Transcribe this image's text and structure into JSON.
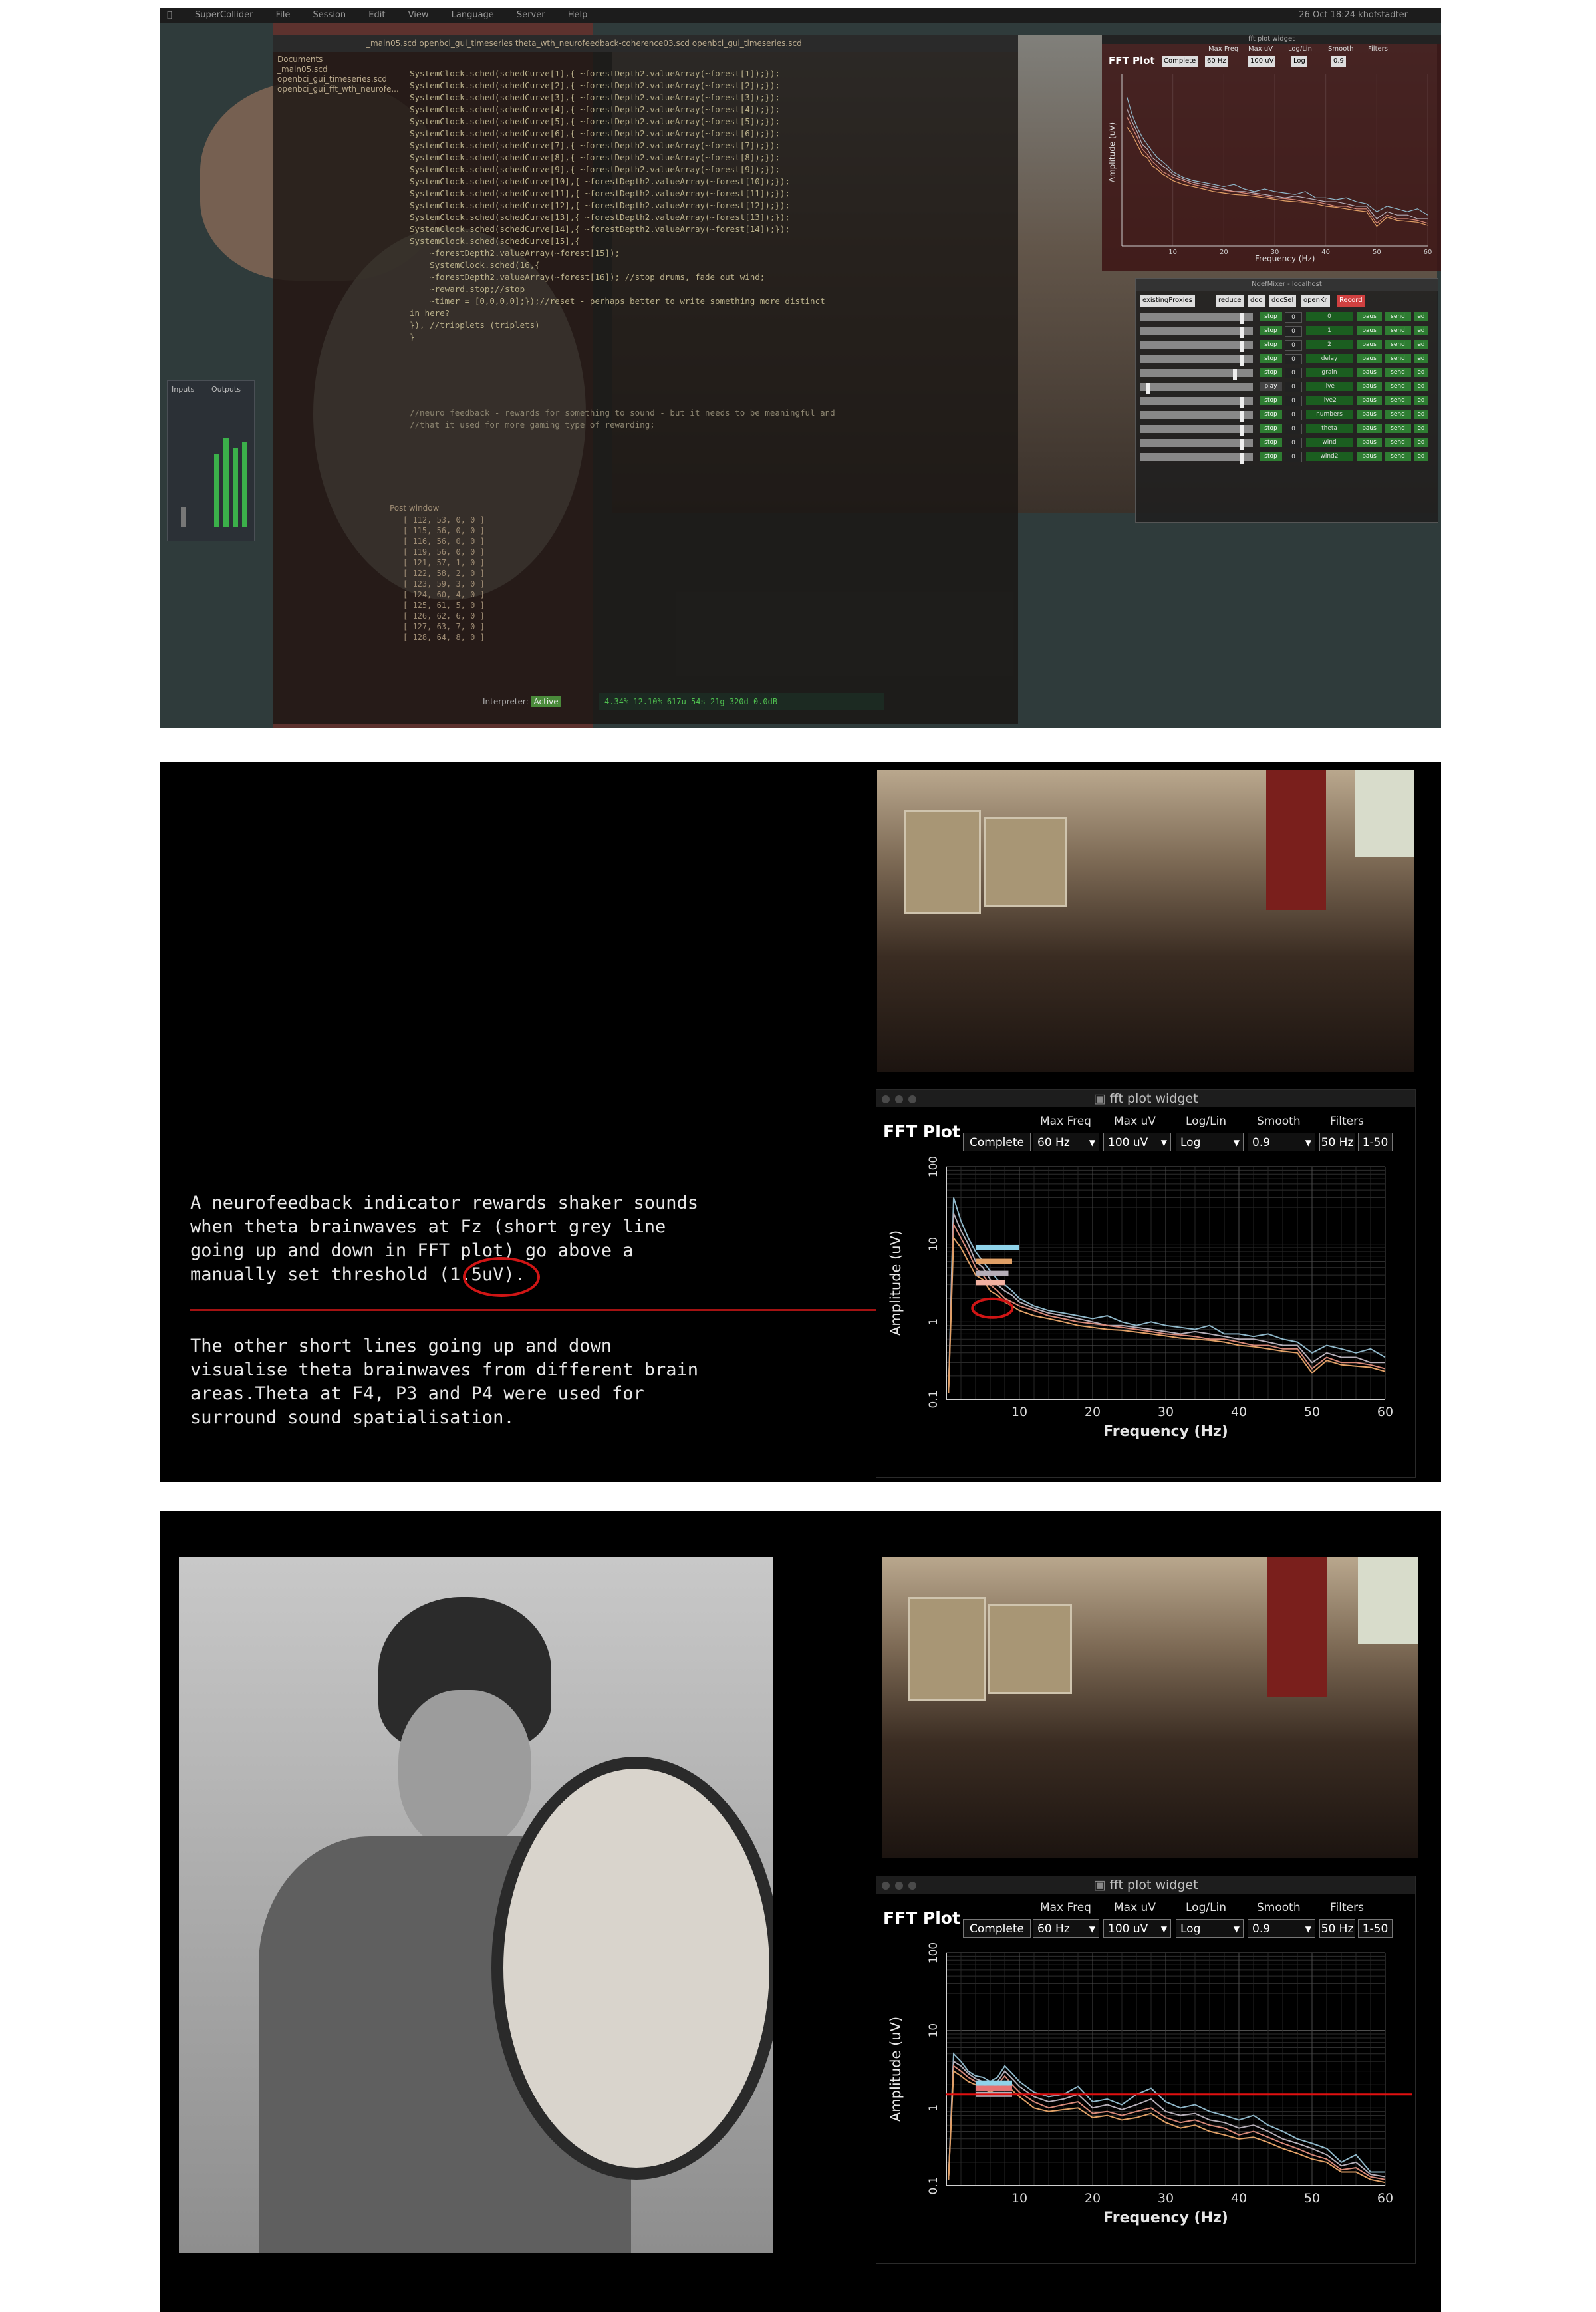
{
  "panel1": {
    "menubar": [
      "SuperCollider",
      "File",
      "Session",
      "Edit",
      "View",
      "Language",
      "Server",
      "Help"
    ],
    "clock": "26 Oct 18:24  khofstadter",
    "editor_tabs": "_main05.scd   openbci_gui_timeseries   theta_wth_neurofeedback-coherence03.scd   openbci_gui_timeseries.scd",
    "documents_label": "Documents",
    "documents": [
      "_main05.scd",
      "openbci_gui_timeseries.scd",
      "openbci_gui_fft_wth_neurofe..."
    ],
    "code_lines": [
      "SystemClock.sched(schedCurve[1],{ ~forestDepth2.valueArray(~forest[1]);});",
      "SystemClock.sched(schedCurve[2],{ ~forestDepth2.valueArray(~forest[2]);});",
      "SystemClock.sched(schedCurve[3],{ ~forestDepth2.valueArray(~forest[3]);});",
      "SystemClock.sched(schedCurve[4],{ ~forestDepth2.valueArray(~forest[4]);});",
      "SystemClock.sched(schedCurve[5],{ ~forestDepth2.valueArray(~forest[5]);});",
      "SystemClock.sched(schedCurve[6],{ ~forestDepth2.valueArray(~forest[6]);});",
      "SystemClock.sched(schedCurve[7],{ ~forestDepth2.valueArray(~forest[7]);});",
      "SystemClock.sched(schedCurve[8],{ ~forestDepth2.valueArray(~forest[8]);});",
      "SystemClock.sched(schedCurve[9],{ ~forestDepth2.valueArray(~forest[9]);});",
      "SystemClock.sched(schedCurve[10],{ ~forestDepth2.valueArray(~forest[10]);});",
      "SystemClock.sched(schedCurve[11],{ ~forestDepth2.valueArray(~forest[11]);});",
      "SystemClock.sched(schedCurve[12],{ ~forestDepth2.valueArray(~forest[12]);});",
      "SystemClock.sched(schedCurve[13],{ ~forestDepth2.valueArray(~forest[13]);});",
      "SystemClock.sched(schedCurve[14],{ ~forestDepth2.valueArray(~forest[14]);});",
      "SystemClock.sched(schedCurve[15],{",
      "    ~forestDepth2.valueArray(~forest[15]);",
      "    SystemClock.sched(16,{",
      "    ~forestDepth2.valueArray(~forest[16]); //stop drums, fade out wind;",
      "    ~reward.stop;//stop",
      "    ~timer = [0,0,0,0];});//reset - perhaps better to write something more distinct",
      "in here?",
      "}), //tripplets (triplets)",
      "",
      "}"
    ],
    "comment_lines": [
      "//neuro feedback - rewards for something to sound - but it needs to be meaningful and",
      "//that it used for more gaming type of rewarding;"
    ],
    "post_window_label": "Post window",
    "post_lines": [
      "[ 112, 53, 0, 0 ]",
      "[ 115, 56, 0, 0 ]",
      "[ 116, 56, 0, 0 ]",
      "[ 119, 56, 0, 0 ]",
      "[ 121, 57, 1, 0 ]",
      "[ 122, 58, 2, 0 ]",
      "[ 123, 59, 3, 0 ]",
      "[ 124, 60, 4, 0 ]",
      "[ 125, 61, 5, 0 ]",
      "[ 126, 62, 6, 0 ]",
      "[ 127, 63, 7, 0 ]",
      "[ 128, 64, 8, 0 ]"
    ],
    "interpreter_label": "Interpreter:",
    "interpreter_state": "Active",
    "server_status": "4.34% 12.10% 617u 54s 21g 320d 0.0dB",
    "meters_inputs": "Inputs",
    "meters_outputs": "Outputs",
    "mini_fft": {
      "title": "FFT Plot",
      "labels": [
        "Max Freq",
        "Max uV",
        "Log/Lin",
        "Smooth",
        "Filters"
      ],
      "controls": [
        "Complete",
        "60 Hz",
        "100 uV",
        "Log",
        "0.9"
      ],
      "ylabel": "Amplitude (uV)",
      "xlabel": "Frequency (Hz)",
      "xticks": [
        "10",
        "20",
        "30",
        "40",
        "50",
        "60"
      ],
      "window_title": "fft plot widget"
    },
    "mixer": {
      "window_title": "NdefMixer - localhost",
      "buttons": [
        "existingProxies",
        "reduce",
        "doc",
        "docSel",
        "openKr",
        "Record"
      ],
      "rows": [
        {
          "state": "stop",
          "n": "0",
          "name": "0"
        },
        {
          "state": "stop",
          "n": "0",
          "name": "1"
        },
        {
          "state": "stop",
          "n": "0",
          "name": "2"
        },
        {
          "state": "stop",
          "n": "0",
          "name": "delay"
        },
        {
          "state": "stop",
          "n": "0",
          "name": "grain"
        },
        {
          "state": "play",
          "n": "0",
          "name": "live"
        },
        {
          "state": "stop",
          "n": "0",
          "name": "live2"
        },
        {
          "state": "stop",
          "n": "0",
          "name": "numbers"
        },
        {
          "state": "stop",
          "n": "0",
          "name": "theta"
        },
        {
          "state": "stop",
          "n": "0",
          "name": "wind"
        },
        {
          "state": "stop",
          "n": "0",
          "name": "wind2"
        }
      ],
      "pause_label": "paus",
      "send_label": "send",
      "ed_label": "ed"
    }
  },
  "panel2": {
    "paragraph1": "A neurofeedback indicator rewards shaker sounds\nwhen theta brainwaves at Fz (short grey line\ngoing up and down in FFT plot) go above a\nmanually set threshold (1.5uV).",
    "paragraph2": "The other short lines going up and down\nvisualise theta brainwaves from different brain\nareas.Theta at F4, P3 and P4 were used for\nsurround sound spatialisation."
  },
  "fft_widget": {
    "window_title": "fft plot widget",
    "title": "FFT Plot",
    "labels": {
      "max_freq": "Max Freq",
      "max_uv": "Max uV",
      "log_lin": "Log/Lin",
      "smooth": "Smooth",
      "filters": "Filters"
    },
    "controls": {
      "complete": "Complete",
      "max_freq": "60 Hz",
      "max_uv": "100 uV",
      "log_lin": "Log",
      "smooth": "0.9",
      "notch": "50 Hz",
      "band": "1-50"
    },
    "ylabel": "Amplitude (uV)",
    "xlabel": "Frequency (Hz)",
    "yticks": [
      "100",
      "10",
      "1",
      "0.1"
    ],
    "xticks": [
      "10",
      "20",
      "30",
      "40",
      "50",
      "60"
    ]
  },
  "colors": {
    "accent_red": "#d01515",
    "divider_red": "#a31212",
    "series": [
      "#8fb7c9",
      "#b5aeb8",
      "#d88a7a",
      "#e0a066",
      "#c9c9c9",
      "#e57373",
      "#f1b0a0"
    ]
  },
  "chart_data": [
    {
      "type": "line",
      "title": "FFT Plot",
      "xlabel": "Frequency (Hz)",
      "ylabel": "Amplitude (uV)",
      "xlim": [
        0,
        60
      ],
      "ylim": [
        0.1,
        100
      ],
      "yscale": "log",
      "grid": true,
      "x": [
        1,
        2,
        3,
        4,
        5,
        6,
        7,
        8,
        9,
        10,
        12,
        14,
        16,
        18,
        20,
        22,
        24,
        26,
        28,
        30,
        32,
        34,
        36,
        38,
        40,
        42,
        44,
        46,
        48,
        50,
        52,
        54,
        56,
        58,
        60
      ],
      "series": [
        {
          "values": [
            40,
            20,
            12,
            8,
            6,
            4.5,
            3.5,
            3,
            2.5,
            2,
            1.6,
            1.4,
            1.3,
            1.2,
            1.1,
            1.2,
            1.0,
            0.9,
            1.0,
            0.9,
            0.85,
            0.8,
            0.9,
            0.7,
            0.7,
            0.65,
            0.7,
            0.6,
            0.55,
            0.4,
            0.5,
            0.45,
            0.4,
            0.45,
            0.35
          ]
        },
        {
          "values": [
            25,
            15,
            10,
            6,
            5,
            3.5,
            3,
            2.5,
            2.2,
            1.8,
            1.5,
            1.3,
            1.2,
            1.1,
            1.0,
            0.9,
            0.9,
            0.85,
            0.8,
            0.75,
            0.7,
            0.75,
            0.7,
            0.65,
            0.6,
            0.6,
            0.55,
            0.5,
            0.5,
            0.3,
            0.4,
            0.35,
            0.35,
            0.3,
            0.3
          ]
        },
        {
          "values": [
            18,
            12,
            8,
            5,
            4,
            3,
            2.5,
            2,
            1.8,
            1.6,
            1.4,
            1.2,
            1.1,
            1.0,
            0.95,
            0.9,
            0.85,
            0.8,
            0.75,
            0.7,
            0.68,
            0.65,
            0.6,
            0.6,
            0.55,
            0.5,
            0.5,
            0.45,
            0.45,
            0.25,
            0.35,
            0.3,
            0.3,
            0.28,
            0.25
          ]
        },
        {
          "values": [
            12,
            9,
            6,
            4,
            3.5,
            2.5,
            2.2,
            1.8,
            1.6,
            1.4,
            1.2,
            1.1,
            1.0,
            0.9,
            0.85,
            0.8,
            0.78,
            0.74,
            0.7,
            0.66,
            0.62,
            0.6,
            0.58,
            0.55,
            0.5,
            0.48,
            0.45,
            0.42,
            0.4,
            0.22,
            0.32,
            0.28,
            0.27,
            0.26,
            0.23
          ]
        }
      ],
      "annotations": [
        "threshold circle at 1.5uV"
      ]
    },
    {
      "type": "line",
      "title": "FFT Plot",
      "xlabel": "Frequency (Hz)",
      "ylabel": "Amplitude (uV)",
      "xlim": [
        0,
        60
      ],
      "ylim": [
        0.1,
        100
      ],
      "yscale": "log",
      "grid": true,
      "threshold": 1.5,
      "x": [
        1,
        2,
        3,
        4,
        5,
        6,
        7,
        8,
        9,
        10,
        12,
        14,
        16,
        18,
        20,
        22,
        24,
        26,
        28,
        30,
        32,
        34,
        36,
        38,
        40,
        42,
        44,
        46,
        48,
        50,
        52,
        54,
        56,
        58,
        60
      ],
      "series": [
        {
          "values": [
            5,
            4,
            3,
            2.6,
            2.5,
            2.2,
            2.5,
            3.5,
            2.8,
            2.2,
            1.6,
            1.4,
            1.5,
            1.9,
            1.2,
            1.3,
            1.1,
            1.5,
            1.8,
            1.2,
            1.0,
            1.1,
            0.9,
            0.8,
            0.7,
            0.8,
            0.6,
            0.5,
            0.4,
            0.35,
            0.3,
            0.2,
            0.25,
            0.15,
            0.15
          ]
        },
        {
          "values": [
            4,
            3.5,
            2.8,
            2.4,
            2.2,
            2.0,
            2.2,
            3.0,
            2.4,
            1.9,
            1.4,
            1.2,
            1.3,
            1.5,
            1.0,
            1.1,
            0.95,
            1.1,
            1.3,
            0.9,
            0.8,
            0.85,
            0.7,
            0.65,
            0.55,
            0.6,
            0.5,
            0.4,
            0.35,
            0.3,
            0.25,
            0.18,
            0.2,
            0.14,
            0.13
          ]
        },
        {
          "values": [
            3.5,
            3,
            2.5,
            2.2,
            2.0,
            1.8,
            2.0,
            2.6,
            2.0,
            1.6,
            1.2,
            1.0,
            1.1,
            1.2,
            0.85,
            0.9,
            0.8,
            0.9,
            1.0,
            0.75,
            0.65,
            0.7,
            0.6,
            0.55,
            0.45,
            0.5,
            0.42,
            0.35,
            0.3,
            0.25,
            0.22,
            0.16,
            0.17,
            0.13,
            0.12
          ]
        },
        {
          "values": [
            3,
            2.6,
            2.2,
            2.0,
            1.8,
            1.6,
            1.8,
            2.2,
            1.7,
            1.4,
            1.0,
            0.9,
            0.95,
            1.0,
            0.75,
            0.8,
            0.7,
            0.75,
            0.85,
            0.65,
            0.55,
            0.6,
            0.5,
            0.45,
            0.4,
            0.42,
            0.36,
            0.3,
            0.26,
            0.22,
            0.2,
            0.15,
            0.15,
            0.12,
            0.11
          ]
        }
      ]
    }
  ]
}
